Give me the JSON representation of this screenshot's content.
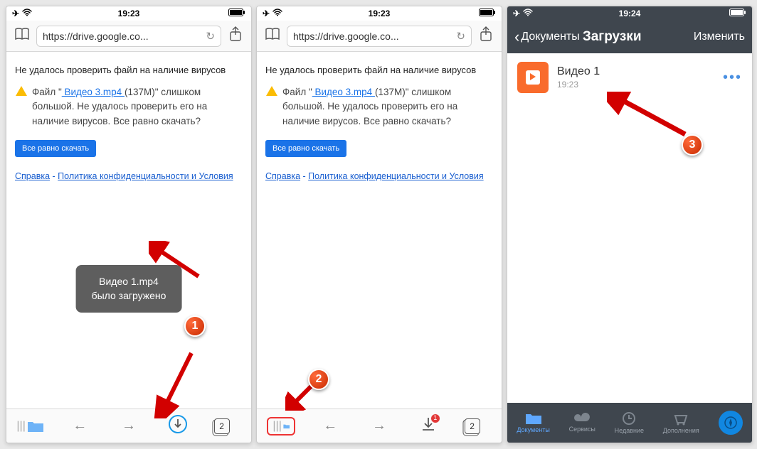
{
  "status": {
    "time_a": "19:23",
    "time_b": "19:23",
    "time_c": "19:24"
  },
  "browser": {
    "url": "https://drive.google.co...",
    "heading": "Не удалось проверить файл на наличие вирусов",
    "body_prefix": "Файл \"",
    "link_file": " Видео 3.mp4 ",
    "body_suffix1": "(137M)\" слишком большой. Не удалось проверить его на наличие вирусов. Все равно скачать?",
    "button": "Все равно скачать",
    "footer_help": "Справка",
    "sep": " - ",
    "footer_policy": "Политика конфиденциальности и Условия "
  },
  "toast": {
    "line1": "Видео 1.mp4",
    "line2": "было загружено"
  },
  "bottom": {
    "badge_count": "1",
    "tab_count": "2"
  },
  "docs": {
    "back_label": "Документы",
    "title": "Загрузки",
    "edit": "Изменить",
    "file_name": "Видео 1",
    "file_time": "19:23",
    "nav": {
      "docs": "Документы",
      "services": "Сервисы",
      "recent": "Недавние",
      "addons": "Дополнения"
    }
  },
  "annotations": {
    "n1": "1",
    "n2": "2",
    "n3": "3"
  }
}
